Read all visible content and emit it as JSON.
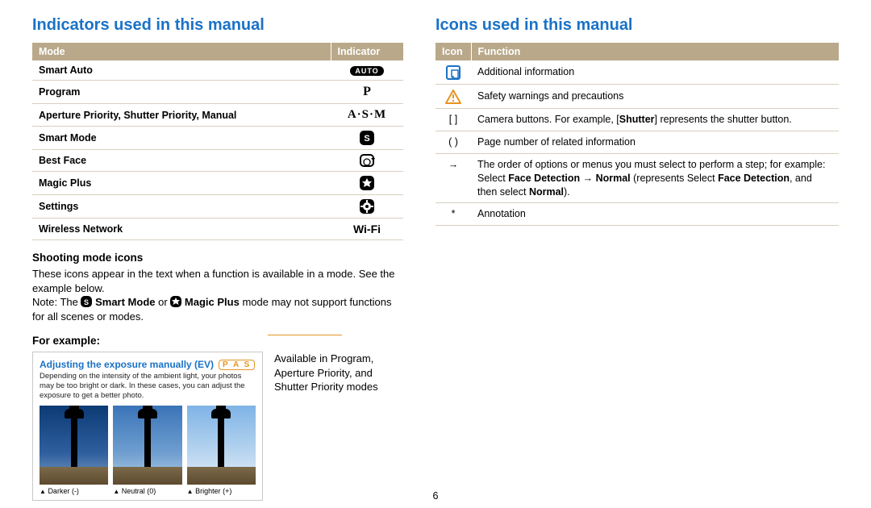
{
  "page_number": "6",
  "left": {
    "title": "Indicators used in this manual",
    "table_headers": {
      "mode": "Mode",
      "indicator": "Indicator"
    },
    "rows": {
      "smart_auto": {
        "mode": "Smart Auto",
        "indicator": "AUTO"
      },
      "program": {
        "mode": "Program",
        "indicator": "P"
      },
      "asm": {
        "mode": "Aperture Priority, Shutter Priority, Manual",
        "indicator": "A·S·M"
      },
      "smart_mode": {
        "mode": "Smart Mode",
        "indicator": "S"
      },
      "best_face": {
        "mode": "Best Face",
        "indicator": ""
      },
      "magic_plus": {
        "mode": "Magic Plus",
        "indicator": ""
      },
      "settings": {
        "mode": "Settings",
        "indicator": ""
      },
      "wifi": {
        "mode": "Wireless Network",
        "indicator": "Wi-Fi"
      }
    },
    "shooting_heading": "Shooting mode icons",
    "shooting_para1": "These icons appear in the text when a function is available in a mode. See the example below.",
    "shooting_note_prefix": "Note: The ",
    "shooting_note_smart": " Smart Mode",
    "shooting_note_or": " or ",
    "shooting_note_magic": " Magic Plus",
    "shooting_note_suffix": " mode may not support functions for all scenes or modes.",
    "for_example_heading": "For example:",
    "example": {
      "title": "Adjusting the exposure manually (EV)",
      "pas": "P A S",
      "desc": "Depending on the intensity of the ambient light, your photos may be too bright or dark. In these cases, you can adjust the exposure to get a better photo.",
      "cap_dark": "Darker (-)",
      "cap_neutral": "Neutral (0)",
      "cap_bright": "Brighter (+)"
    },
    "callout": "Available in Program, Aperture Priority, and Shutter Priority modes"
  },
  "right": {
    "title": "Icons used in this manual",
    "table_headers": {
      "icon": "Icon",
      "function": "Function"
    },
    "rows": {
      "info": {
        "func": "Additional information"
      },
      "warn": {
        "func": "Safety warnings and precautions"
      },
      "brackets": {
        "icon": "[   ]",
        "func_pre": "Camera buttons. For example, [",
        "func_bold": "Shutter",
        "func_post": "] represents the shutter button."
      },
      "parens": {
        "icon": "(   )",
        "func": "Page number of related information"
      },
      "arrow": {
        "icon": "→",
        "func_pre": "The order of options or menus you must select to perform a step; for example: Select ",
        "b1": "Face Detection",
        "mid": " → ",
        "b2": "Normal",
        "paren_pre": " (represents Select ",
        "b3": "Face Detection",
        "then_sel": ", and then select ",
        "b4": "Normal",
        "paren_post": ")."
      },
      "asterisk": {
        "icon": "*",
        "func": "Annotation"
      }
    }
  }
}
